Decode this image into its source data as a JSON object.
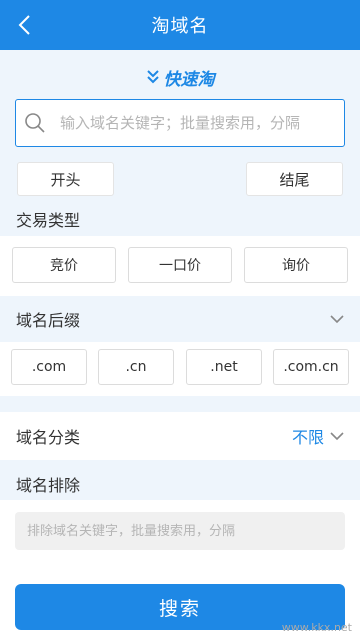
{
  "header": {
    "title": "淘域名",
    "back_icon": "back-arrow-icon"
  },
  "brand": {
    "text": "快速淘",
    "icon": "double-chevron-down-icon",
    "color": "#1e88e5"
  },
  "search": {
    "placeholder": "输入域名关键字；批量搜索用，分隔",
    "value": ""
  },
  "position": {
    "start_label": "开头",
    "end_label": "结尾"
  },
  "trade_type": {
    "label": "交易类型",
    "options": [
      "竞价",
      "一口价",
      "询价"
    ]
  },
  "suffix": {
    "label": "域名后缀",
    "options": [
      ".com",
      ".cn",
      ".net",
      ".com.cn"
    ]
  },
  "category": {
    "label": "域名分类",
    "value": "不限"
  },
  "exclude": {
    "label": "域名排除",
    "placeholder": "排除域名关键字，批量搜索用，分隔",
    "value": ""
  },
  "action": {
    "search_label": "搜索"
  },
  "watermark": {
    "text": "www.kkx.net"
  },
  "colors": {
    "primary": "#1e88e5",
    "background": "#eef5fc"
  }
}
